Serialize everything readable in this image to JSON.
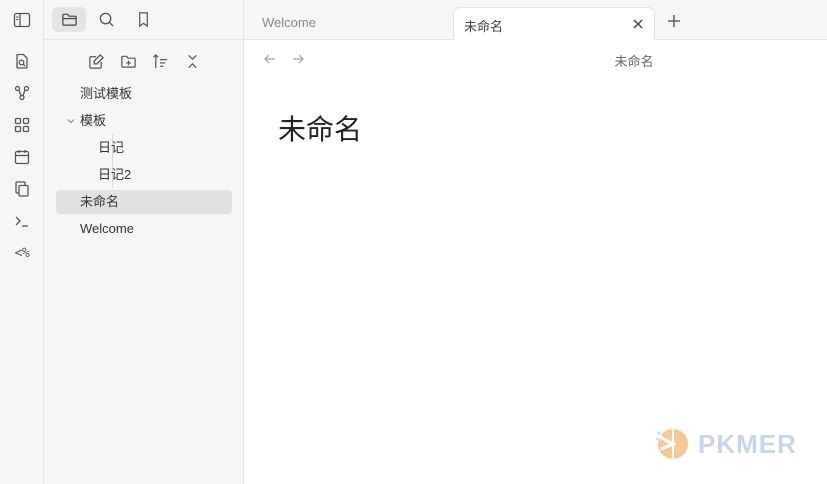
{
  "sidebar": {
    "tree": [
      {
        "label": "测试模板",
        "type": "file"
      },
      {
        "label": "模板",
        "type": "folder",
        "expanded": true
      },
      {
        "label": "日记",
        "type": "file"
      },
      {
        "label": "日记2",
        "type": "file"
      },
      {
        "label": "未命名",
        "type": "file",
        "active": true
      },
      {
        "label": "Welcome",
        "type": "file"
      }
    ]
  },
  "ribbon": {
    "templater_label": "<%"
  },
  "tabs": [
    {
      "label": "Welcome",
      "active": false
    },
    {
      "label": "未命名",
      "active": true
    }
  ],
  "view": {
    "header_title": "未命名",
    "note_title": "未命名"
  },
  "watermark": {
    "text": "PKMER"
  },
  "colors": {
    "background": "#ffffff",
    "sidebar_bg": "#f6f6f6",
    "active_item": "#e2e2e2",
    "watermark": "#c7d3f0"
  }
}
